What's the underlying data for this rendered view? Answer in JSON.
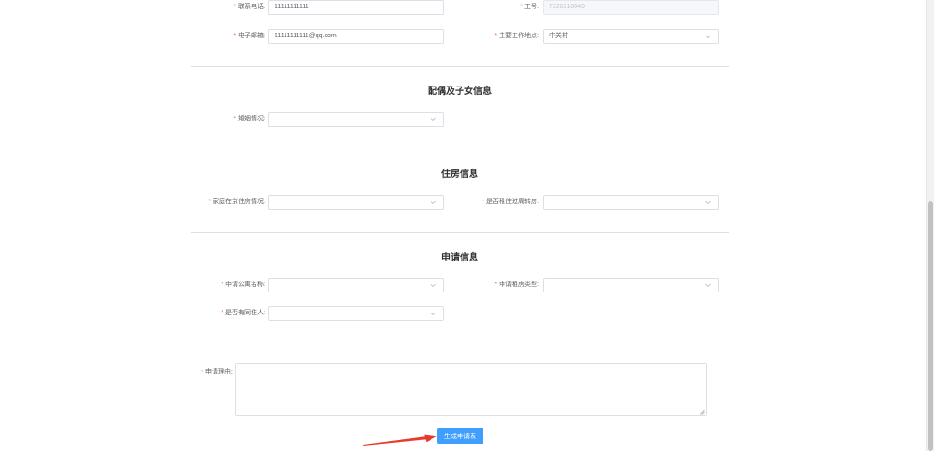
{
  "form": {
    "phone": {
      "label": "联系电话:",
      "value": "11111111111"
    },
    "employee_id": {
      "label": "工号:",
      "value": "7220210040"
    },
    "email": {
      "label": "电子邮箱:",
      "value": "11111111111@qq.com"
    },
    "work_location": {
      "label": "主要工作地点:",
      "value": "中关村"
    },
    "marital_status": {
      "label": "婚姻情况:",
      "value": ""
    },
    "home_housing": {
      "label": "家庭在京住房情况:",
      "value": ""
    },
    "lived_turnover": {
      "label": "是否租住过周转房:",
      "value": ""
    },
    "apartment_name": {
      "label": "申请公寓名称:",
      "value": ""
    },
    "room_type": {
      "label": "申请租房类型:",
      "value": ""
    },
    "cohabitant": {
      "label": "是否有同住人:",
      "value": ""
    },
    "reason": {
      "label": "申请理由:",
      "value": ""
    }
  },
  "sections": {
    "spouse": "配偶及子女信息",
    "housing": "住房信息",
    "application": "申请信息"
  },
  "actions": {
    "submit_label": "生成申请表"
  },
  "required_mark": "*",
  "colors": {
    "primary": "#409eff",
    "required": "#f56c6c",
    "arrow": "#e8392b"
  },
  "icons": {
    "select_caret": "chevron-down-icon",
    "pointer": "red-arrow-annotation"
  }
}
